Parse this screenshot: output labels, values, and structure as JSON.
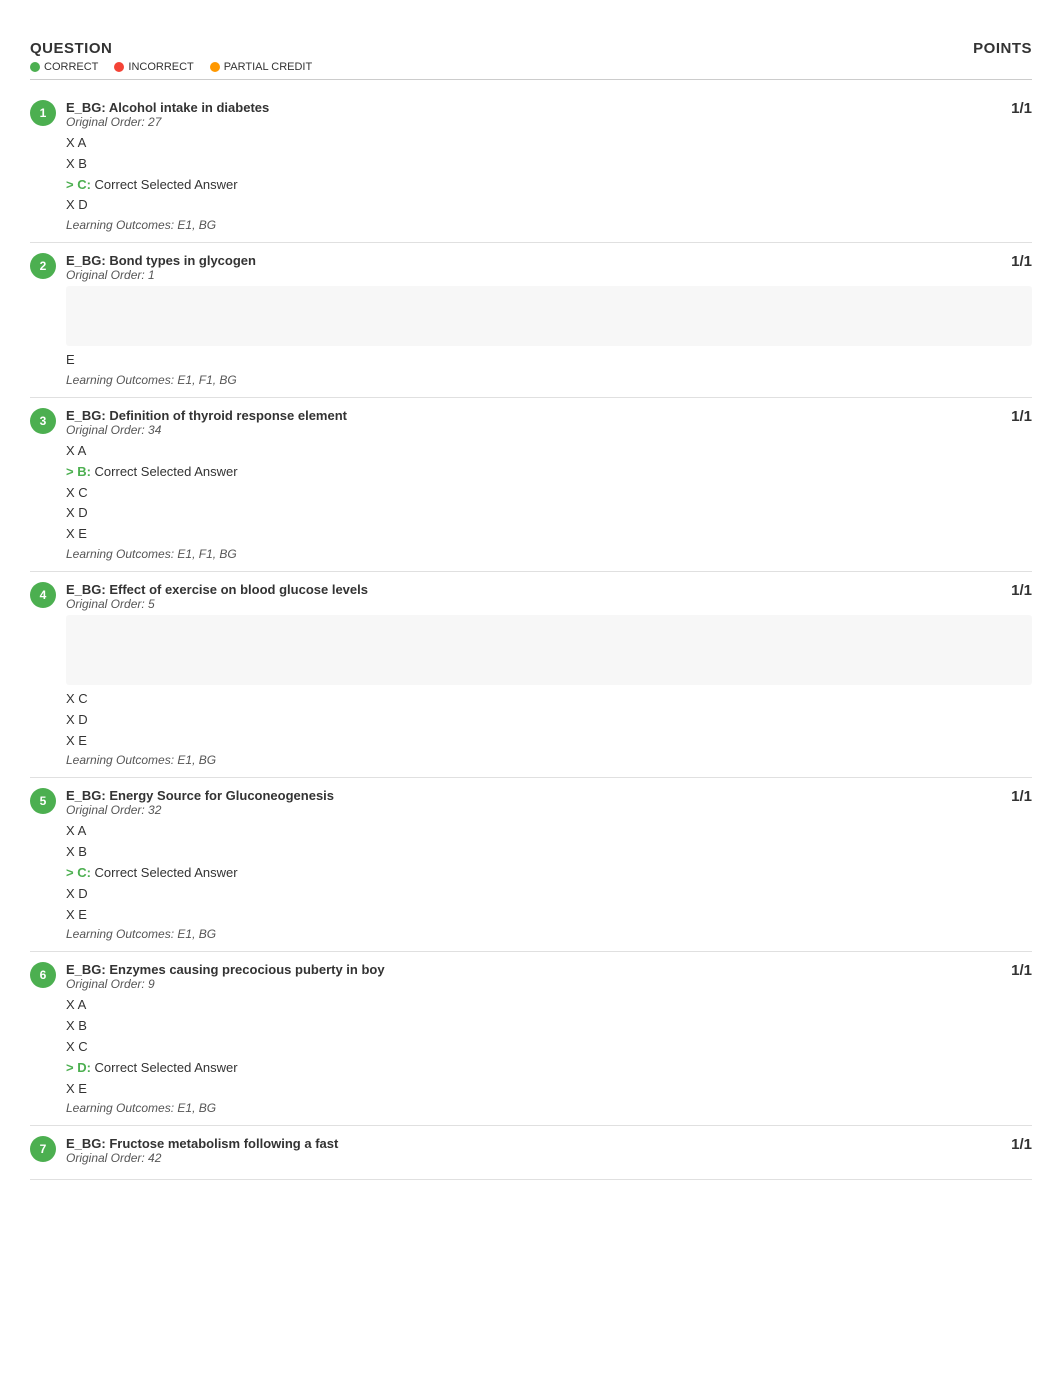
{
  "header": {
    "question_label": "QUESTION",
    "points_label": "POINTS",
    "legend": [
      {
        "id": "correct",
        "label": "CORRECT",
        "dot": "correct"
      },
      {
        "id": "incorrect",
        "label": "INCORRECT",
        "dot": "incorrect"
      },
      {
        "id": "partial",
        "label": "PARTIAL CREDIT",
        "dot": "partial"
      }
    ]
  },
  "questions": [
    {
      "id": 1,
      "badge": "1",
      "badge_type": "correct",
      "title": "E_BG: Alcohol intake in diabetes",
      "order": "Original Order: 27",
      "points": "1/1",
      "answers": [
        {
          "prefix": "X",
          "letter": "A",
          "label": "",
          "type": "wrong"
        },
        {
          "prefix": "X",
          "letter": "B",
          "label": "",
          "type": "wrong"
        },
        {
          "prefix": ">",
          "letter": "C",
          "label": "Correct Selected Answer",
          "type": "correct-selected"
        },
        {
          "prefix": "X",
          "letter": "D",
          "label": "",
          "type": "wrong"
        }
      ],
      "outcomes": "Learning Outcomes: E1, BG"
    },
    {
      "id": 2,
      "badge": "2",
      "badge_type": "correct",
      "title": "E_BG: Bond types in glycogen",
      "order": "Original Order: 1",
      "points": "1/1",
      "answers": [
        {
          "prefix": "",
          "letter": "E",
          "label": "",
          "type": "normal"
        }
      ],
      "has_blurred": true,
      "outcomes": "Learning Outcomes: E1, F1, BG"
    },
    {
      "id": 3,
      "badge": "3",
      "badge_type": "correct",
      "title": "E_BG: Definition of thyroid response element",
      "order": "Original Order: 34",
      "points": "1/1",
      "answers": [
        {
          "prefix": "X",
          "letter": "A",
          "label": "",
          "type": "wrong"
        },
        {
          "prefix": ">",
          "letter": "B",
          "label": "Correct Selected Answer",
          "type": "correct-selected"
        },
        {
          "prefix": "X",
          "letter": "C",
          "label": "",
          "type": "wrong"
        },
        {
          "prefix": "X",
          "letter": "D",
          "label": "",
          "type": "wrong"
        },
        {
          "prefix": "X",
          "letter": "E",
          "label": "",
          "type": "wrong"
        }
      ],
      "outcomes": "Learning Outcomes: E1, F1, BG"
    },
    {
      "id": 4,
      "badge": "4",
      "badge_type": "correct",
      "title": "E_BG: Effect of exercise on blood glucose levels",
      "order": "Original Order: 5",
      "points": "1/1",
      "answers": [
        {
          "prefix": "X",
          "letter": "C",
          "label": "",
          "type": "wrong"
        },
        {
          "prefix": "X",
          "letter": "D",
          "label": "",
          "type": "wrong"
        },
        {
          "prefix": "X",
          "letter": "E",
          "label": "",
          "type": "wrong"
        }
      ],
      "has_blurred_top": true,
      "outcomes": "Learning Outcomes: E1, BG"
    },
    {
      "id": 5,
      "badge": "5",
      "badge_type": "correct",
      "title": "E_BG: Energy Source for Gluconeogenesis",
      "order": "Original Order: 32",
      "points": "1/1",
      "answers": [
        {
          "prefix": "X",
          "letter": "A",
          "label": "",
          "type": "wrong"
        },
        {
          "prefix": "X",
          "letter": "B",
          "label": "",
          "type": "wrong"
        },
        {
          "prefix": ">",
          "letter": "C",
          "label": "Correct Selected Answer",
          "type": "correct-selected"
        },
        {
          "prefix": "X",
          "letter": "D",
          "label": "",
          "type": "wrong"
        },
        {
          "prefix": "X",
          "letter": "E",
          "label": "",
          "type": "wrong"
        }
      ],
      "outcomes": "Learning Outcomes: E1, BG"
    },
    {
      "id": 6,
      "badge": "6",
      "badge_type": "correct",
      "title": "E_BG: Enzymes causing precocious puberty in boy",
      "order": "Original Order: 9",
      "points": "1/1",
      "answers": [
        {
          "prefix": "X",
          "letter": "A",
          "label": "",
          "type": "wrong"
        },
        {
          "prefix": "X",
          "letter": "B",
          "label": "",
          "type": "wrong"
        },
        {
          "prefix": "X",
          "letter": "C",
          "label": "",
          "type": "wrong"
        },
        {
          "prefix": ">",
          "letter": "D",
          "label": "Correct Selected Answer",
          "type": "correct-selected"
        },
        {
          "prefix": "X",
          "letter": "E",
          "label": "",
          "type": "wrong"
        }
      ],
      "outcomes": "Learning Outcomes: E1, BG"
    },
    {
      "id": 7,
      "badge": "7",
      "badge_type": "correct",
      "title": "E_BG: Fructose metabolism following a fast",
      "order": "Original Order: 42",
      "points": "1/1",
      "answers": [],
      "outcomes": ""
    }
  ]
}
